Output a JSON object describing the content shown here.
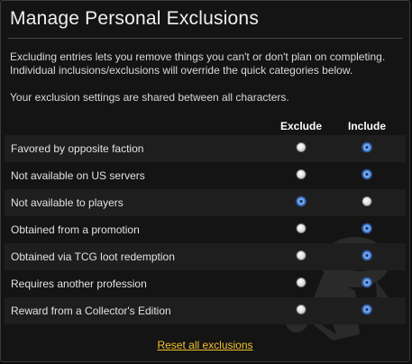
{
  "title": "Manage Personal Exclusions",
  "description": "Excluding entries lets you remove things you can't or don't plan on completing. Individual inclusions/exclusions will override the quick categories below.",
  "shared_note": "Your exclusion settings are shared between all characters.",
  "columns": {
    "exclude": "Exclude",
    "include": "Include"
  },
  "rows": [
    {
      "label": "Favored by opposite faction",
      "selected": "include"
    },
    {
      "label": "Not available on US servers",
      "selected": "include"
    },
    {
      "label": "Not available to players",
      "selected": "exclude"
    },
    {
      "label": "Obtained from a promotion",
      "selected": "include"
    },
    {
      "label": "Obtained via TCG loot redemption",
      "selected": "include"
    },
    {
      "label": "Requires another profession",
      "selected": "include"
    },
    {
      "label": "Reward from a Collector's Edition",
      "selected": "include"
    }
  ],
  "reset_link": "Reset all exclusions",
  "watermark_icon": "guardian-mascot-icon",
  "colors": {
    "link": "#f3c32b",
    "selected_radio": "#4f8fe0",
    "background": "#141414"
  }
}
